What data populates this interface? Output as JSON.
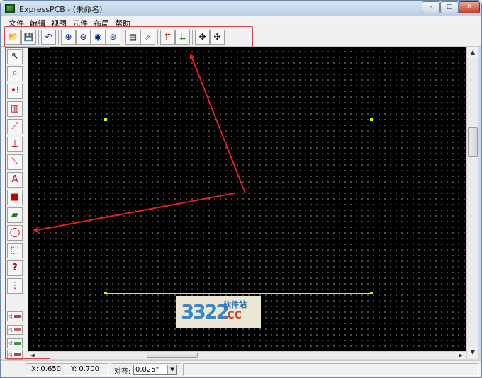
{
  "window": {
    "title": "ExpressPCB - (未命名)",
    "controls": {
      "minimize": "–",
      "maximize": "□",
      "close": "✕"
    }
  },
  "menu": {
    "items": [
      "文件",
      "编辑",
      "视图",
      "元件",
      "布局",
      "帮助"
    ]
  },
  "toolbar": {
    "buttons": [
      {
        "name": "open-icon",
        "glyph": "📂"
      },
      {
        "name": "save-icon",
        "glyph": "💾"
      },
      {
        "name": "undo-icon",
        "glyph": "↶"
      },
      {
        "name": "zoom-in-icon",
        "glyph": "⊕"
      },
      {
        "name": "zoom-out-icon",
        "glyph": "⊖"
      },
      {
        "name": "zoom-window-icon",
        "glyph": "◉"
      },
      {
        "name": "zoom-fit-icon",
        "glyph": "⊛"
      },
      {
        "name": "component-manager-icon",
        "glyph": "▤"
      },
      {
        "name": "send-order-icon",
        "glyph": "⇗"
      },
      {
        "name": "top-layer-icon",
        "glyph": "⇈"
      },
      {
        "name": "bottom-layer-icon",
        "glyph": "⇊"
      },
      {
        "name": "move-icon",
        "glyph": "✥"
      },
      {
        "name": "rotate-icon",
        "glyph": "✣"
      }
    ]
  },
  "left_tools": {
    "buttons": [
      {
        "name": "select-tool-icon",
        "glyph": "↖"
      },
      {
        "name": "zoom-tool-icon",
        "glyph": "⌕"
      },
      {
        "name": "place-pad-icon",
        "glyph": "•⁞"
      },
      {
        "name": "place-component-icon",
        "glyph": "▥"
      },
      {
        "name": "draw-trace-icon",
        "glyph": "⟋"
      },
      {
        "name": "trace-angle-icon",
        "glyph": "⊥"
      },
      {
        "name": "trace-diagonal-icon",
        "glyph": "⟍"
      },
      {
        "name": "place-text-icon",
        "glyph": "A"
      },
      {
        "name": "layer-color-icon",
        "glyph": "■"
      },
      {
        "name": "ground-plane-icon",
        "glyph": "▰"
      },
      {
        "name": "circle-tool-icon",
        "glyph": "◯"
      },
      {
        "name": "board-outline-icon",
        "glyph": "⬚"
      },
      {
        "name": "net-query-icon",
        "glyph": "?"
      },
      {
        "name": "netlist-icon",
        "glyph": "⋮"
      }
    ],
    "layer_buttons": [
      {
        "name": "layer-top-copper-icon",
        "glyph": "◁"
      },
      {
        "name": "layer-bottom-copper-icon",
        "glyph": "◁"
      },
      {
        "name": "layer-silkscreen-icon",
        "glyph": "◁"
      },
      {
        "name": "layer-extra-icon",
        "glyph": "◁"
      }
    ]
  },
  "status": {
    "x": "X: 0.650",
    "y": "Y: 0.700",
    "snap_label": "对齐:",
    "snap_value": "0.025\""
  },
  "watermark": {
    "digits": "3322",
    "site_cn": "软件站",
    "domain": ".CC"
  },
  "colors": {
    "canvas": "#000000",
    "board_outline": "#e8e800",
    "grid_dot": "#8c8c8c",
    "annotation_red": "#e02020"
  }
}
